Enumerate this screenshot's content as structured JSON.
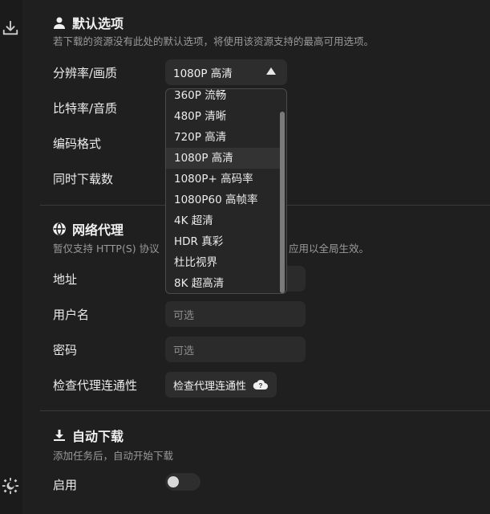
{
  "sections": {
    "defaults": {
      "title": "默认选项",
      "desc": "若下载的资源没有此处的默认选项，将使用该资源支持的最高可用选项。",
      "resolution_label": "分辨率/画质",
      "resolution_value": "1080P 高清",
      "bitrate_label": "比特率/音质",
      "codec_label": "编码格式",
      "concurrent_label": "同时下载数"
    },
    "proxy": {
      "title": "网络代理",
      "desc_left": "暂仅支持 HTTP(S) 协议",
      "desc_right": "应用以全局生效。",
      "address_label": "地址",
      "username_label": "用户名",
      "username_placeholder": "可选",
      "password_label": "密码",
      "password_placeholder": "可选",
      "check_label": "检查代理连通性",
      "check_button": "检查代理连通性"
    },
    "autodownload": {
      "title": "自动下载",
      "desc": "添加任务后，自动开始下载",
      "enable_label": "启用",
      "enabled": false
    }
  },
  "dropdown": {
    "options": [
      "360P 流畅",
      "480P 清晰",
      "720P 高清",
      "1080P 高清",
      "1080P+ 高码率",
      "1080P60 高帧率",
      "4K 超清",
      "HDR 真彩",
      "杜比视界",
      "8K 超高清"
    ],
    "selected": "1080P 高清"
  },
  "icons": {
    "rail_top": "download-icon",
    "rail_bottom": "settings-theme-icon",
    "defaults": "user-icon",
    "proxy": "globe-icon",
    "autodownload": "download-icon",
    "check": "cloud-question-icon"
  }
}
